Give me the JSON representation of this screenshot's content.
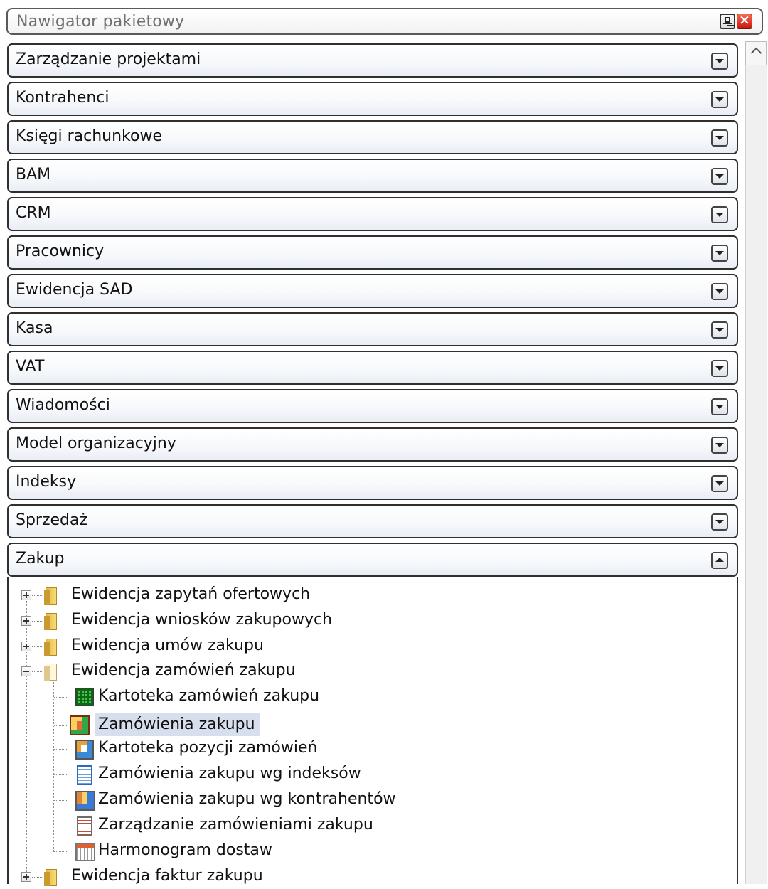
{
  "window": {
    "title": "Nawigator pakietowy",
    "pin_icon": "pin-icon",
    "close_icon": "close-icon"
  },
  "sections": [
    {
      "label": "Zarządzanie projektami",
      "expanded": false
    },
    {
      "label": "Kontrahenci",
      "expanded": false
    },
    {
      "label": "Księgi rachunkowe",
      "expanded": false
    },
    {
      "label": "BAM",
      "expanded": false
    },
    {
      "label": "CRM",
      "expanded": false
    },
    {
      "label": "Pracownicy",
      "expanded": false
    },
    {
      "label": "Ewidencja SAD",
      "expanded": false
    },
    {
      "label": "Kasa",
      "expanded": false
    },
    {
      "label": "VAT",
      "expanded": false
    },
    {
      "label": "Wiadomości",
      "expanded": false
    },
    {
      "label": "Model organizacyjny",
      "expanded": false
    },
    {
      "label": "Indeksy",
      "expanded": false
    },
    {
      "label": "Sprzedaż",
      "expanded": false
    },
    {
      "label": "Zakup",
      "expanded": true
    }
  ],
  "tree": {
    "folders": [
      {
        "label": "Ewidencja zapytań ofertowych",
        "expanded": false
      },
      {
        "label": "Ewidencja wniosków zakupowych",
        "expanded": false
      },
      {
        "label": "Ewidencja umów zakupu",
        "expanded": false
      },
      {
        "label": "Ewidencja zamówień zakupu",
        "expanded": true
      },
      {
        "label": "Ewidencja faktur zakupu",
        "expanded": false
      }
    ],
    "children": [
      {
        "label": "Kartoteka zamówień zakupu",
        "icon": "green-grid-icon",
        "selected": false
      },
      {
        "label": "Zamówienia zakupu",
        "icon": "purchase-order-icon",
        "selected": true
      },
      {
        "label": "Kartoteka pozycji zamówień",
        "icon": "order-items-icon",
        "selected": false
      },
      {
        "label": "Zamówienia zakupu wg indeksów",
        "icon": "index-list-icon",
        "selected": false
      },
      {
        "label": "Zamówienia zakupu wg kontrahentów",
        "icon": "contractor-orders-icon",
        "selected": false
      },
      {
        "label": "Zarządzanie zamówieniami zakupu",
        "icon": "document-list-icon",
        "selected": false
      },
      {
        "label": "Harmonogram dostaw",
        "icon": "calendar-icon",
        "selected": false
      }
    ]
  }
}
